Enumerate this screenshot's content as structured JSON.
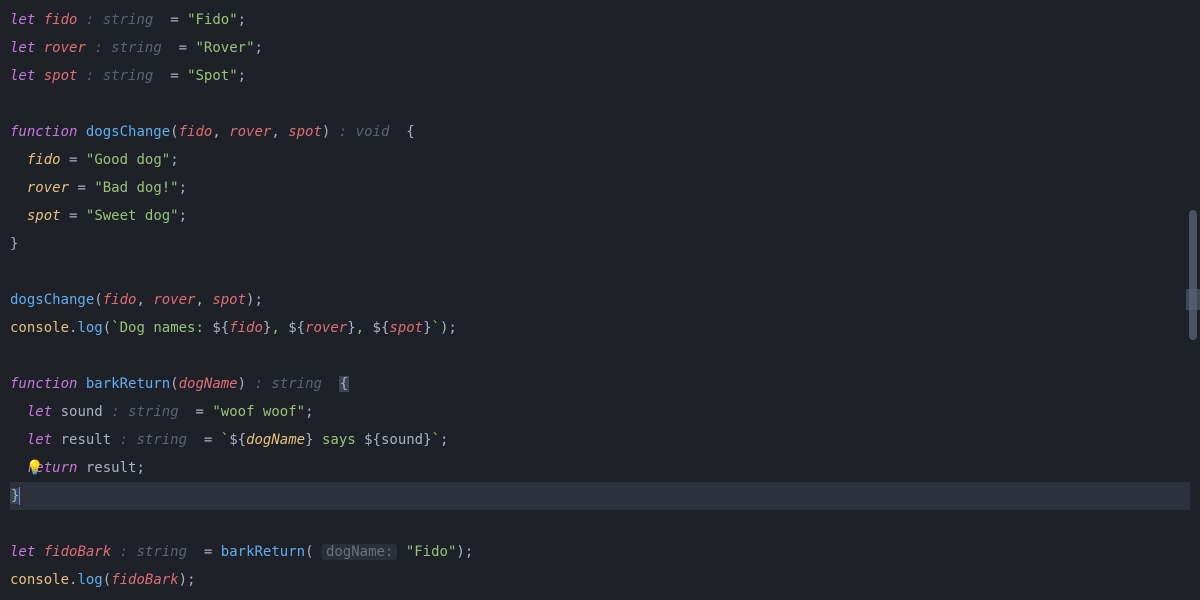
{
  "colors": {
    "background": "#1e2127",
    "text": "#abb2bf",
    "keyword": "#c678dd",
    "function": "#61afef",
    "variable": "#e06c75",
    "param": "#e5c07b",
    "string": "#98c379",
    "annotation": "#5c6370",
    "hintBg": "#2a2f38",
    "highlightLine": "#2c313c",
    "bulb": "#e5c07b"
  },
  "language": "TypeScript",
  "code": {
    "declarations": [
      {
        "keyword": "let",
        "name": "fido",
        "typeHint": ": string",
        "op": "=",
        "value": "\"Fido\"",
        "term": ";"
      },
      {
        "keyword": "let",
        "name": "rover",
        "typeHint": ": string",
        "op": "=",
        "value": "\"Rover\"",
        "term": ";"
      },
      {
        "keyword": "let",
        "name": "spot",
        "typeHint": ": string",
        "op": "=",
        "value": "\"Spot\"",
        "term": ";"
      }
    ],
    "func1": {
      "keyword": "function",
      "name": "dogsChange",
      "params": [
        "fido",
        "rover",
        "spot"
      ],
      "returnHint": ": void",
      "body": [
        {
          "target": "fido",
          "op": "=",
          "value": "\"Good dog\"",
          "term": ";"
        },
        {
          "target": "rover",
          "op": "=",
          "value": "\"Bad dog!\"",
          "term": ";"
        },
        {
          "target": "spot",
          "op": "=",
          "value": "\"Sweet dog\"",
          "term": ";"
        }
      ]
    },
    "call1": {
      "name": "dogsChange",
      "args": [
        "fido",
        "rover",
        "spot"
      ],
      "term": ";"
    },
    "log1": {
      "object": "console",
      "method": "log",
      "templatePrefix": "Dog names: ",
      "interp": [
        "fido",
        "rover",
        "spot"
      ],
      "sepInside": ", "
    },
    "func2": {
      "keyword": "function",
      "name": "barkReturn",
      "params": [
        "dogName"
      ],
      "returnHint": ": string",
      "body": {
        "soundDecl": {
          "keyword": "let",
          "name": "sound",
          "typeHint": ": string",
          "op": "=",
          "value": "\"woof woof\"",
          "term": ";"
        },
        "resultDecl": {
          "keyword": "let",
          "name": "result",
          "typeHint": ": string",
          "op": "=",
          "templateParts": {
            "interp1": "dogName",
            "mid": " says ",
            "interp2": "sound"
          },
          "term": ";"
        },
        "ret": {
          "keyword": "return",
          "name": "result",
          "term": ";"
        }
      }
    },
    "decl2": {
      "keyword": "let",
      "name": "fidoBark",
      "typeHint": ": string",
      "op": "=",
      "call": {
        "name": "barkReturn",
        "paramHint": "dogName:",
        "arg": "\"Fido\""
      },
      "term": ";"
    },
    "log2": {
      "object": "console",
      "method": "log",
      "arg": "fidoBark",
      "term": ";"
    }
  },
  "ui": {
    "lightbulb": "💡",
    "highlightedBraceLine": 18,
    "activeLineHighlight": true
  }
}
